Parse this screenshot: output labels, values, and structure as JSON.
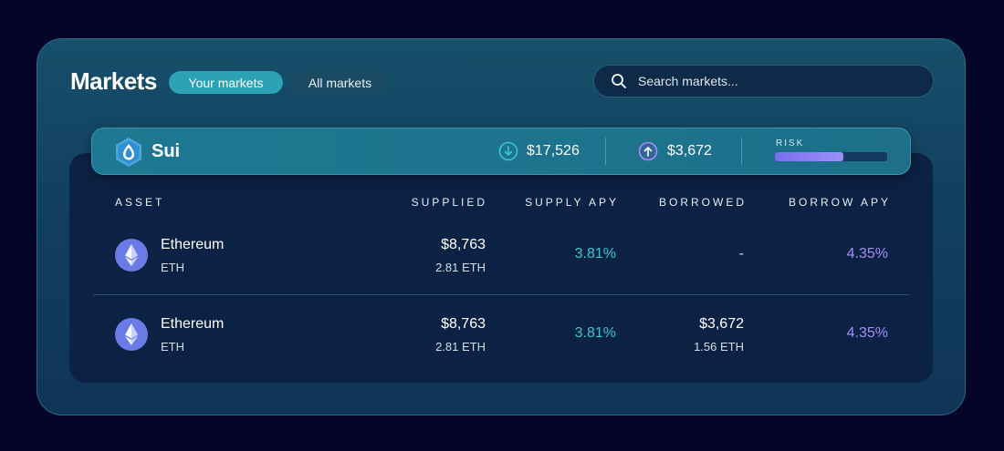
{
  "header": {
    "title": "Markets",
    "tabs": [
      {
        "label": "Your markets",
        "active": true
      },
      {
        "label": "All markets",
        "active": false
      }
    ],
    "search": {
      "placeholder": "Search markets...",
      "value": ""
    }
  },
  "market": {
    "name": "Sui",
    "logo_icon": "sui-drop-icon",
    "supplied_total": "$17,526",
    "borrowed_total": "$3,672",
    "risk_label": "RISK",
    "risk_fraction": 0.61
  },
  "table": {
    "columns": [
      "ASSET",
      "SUPPLIED",
      "SUPPLY APY",
      "BORROWED",
      "BORROW APY"
    ],
    "rows": [
      {
        "asset_name": "Ethereum",
        "asset_symbol": "ETH",
        "supplied_usd": "$8,763",
        "supplied_amount": "2.81 ETH",
        "supply_apy": "3.81%",
        "borrowed_usd": "-",
        "borrowed_amount": "",
        "borrow_apy": "4.35%"
      },
      {
        "asset_name": "Ethereum",
        "asset_symbol": "ETH",
        "supplied_usd": "$8,763",
        "supplied_amount": "2.81 ETH",
        "supply_apy": "3.81%",
        "borrowed_usd": "$3,672",
        "borrowed_amount": "1.56 ETH",
        "borrow_apy": "4.35%"
      }
    ]
  },
  "colors": {
    "accent_teal": "#2ba2b5",
    "supply_apy": "#3cc6d2",
    "borrow_apy": "#a58ef6",
    "risk_fill": "#8b7ef3"
  }
}
